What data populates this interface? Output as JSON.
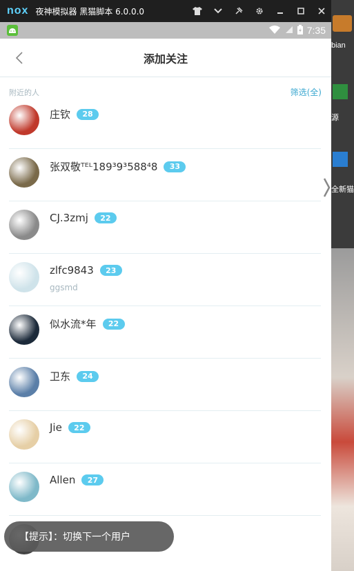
{
  "emulator": {
    "logo": "nox",
    "title": "夜神模拟器 黑猫脚本 6.0.0.0",
    "icons": [
      "shirt-icon",
      "chevron-down-icon",
      "pin-icon",
      "gear-icon",
      "minimize-icon",
      "maximize-icon",
      "close-icon"
    ]
  },
  "statusbar": {
    "time": "7:35",
    "icons": [
      "android-icon",
      "wifi-icon",
      "signal-icon",
      "battery-icon"
    ]
  },
  "navbar": {
    "title": "添加关注"
  },
  "section": {
    "label": "附近的人",
    "filter": "筛选(全)"
  },
  "users": [
    {
      "name": "庄钦",
      "age": "28",
      "sub": "",
      "avatar_color": "#c0392b"
    },
    {
      "name": "张双敬ᵀᴱᴸ189³9³588⁴8",
      "age": "33",
      "sub": "",
      "avatar_color": "#7a6a4a"
    },
    {
      "name": "CJ.3zmj",
      "age": "22",
      "sub": "",
      "avatar_color": "#8a8a8a"
    },
    {
      "name": "zlfc9843",
      "age": "23",
      "sub": "ggsmd",
      "avatar_color": "#cfe3ea"
    },
    {
      "name": "似水流*年",
      "age": "22",
      "sub": "",
      "avatar_color": "#1c2a3a"
    },
    {
      "name": "卫东",
      "age": "24",
      "sub": "",
      "avatar_color": "#5b7fa8"
    },
    {
      "name": "Jie",
      "age": "22",
      "sub": "",
      "avatar_color": "#e6cfa6"
    },
    {
      "name": "Allen",
      "age": "27",
      "sub": "",
      "avatar_color": "#7fb9c9"
    },
    {
      "name": "",
      "age": "",
      "sub": "",
      "avatar_color": "#444"
    }
  ],
  "toast": {
    "text": "【提示】：切换下一个用户"
  },
  "desktop": {
    "labels": [
      "bian",
      "源",
      "全新猫"
    ]
  },
  "colors": {
    "accent": "#5ccbee",
    "link": "#3aa7d0"
  }
}
